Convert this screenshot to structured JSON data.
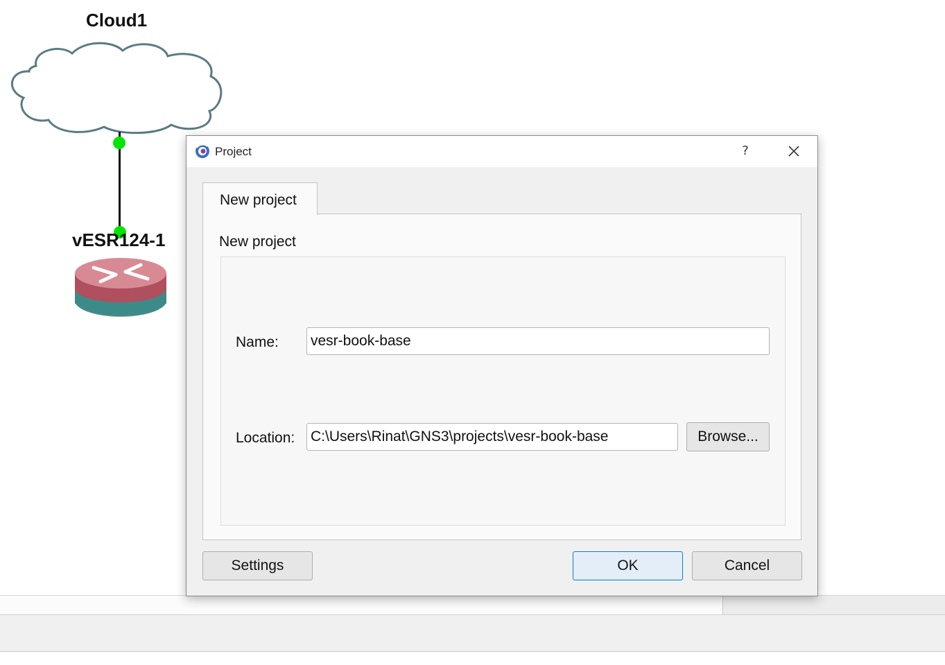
{
  "canvas": {
    "cloud_label": "Cloud1",
    "router_label": "vESR124-1",
    "port_color": "#00e600",
    "cloud_stroke": "#5b7a84"
  },
  "dialog": {
    "title": "Project",
    "app_icon": "gns3-icon",
    "help_label": "?",
    "tab_label": "New project",
    "group_title": "New project",
    "name_label": "Name:",
    "name_value": "vesr-book-base",
    "location_label": "Location:",
    "location_value": "C:\\Users\\Rinat\\GNS3\\projects\\vesr-book-base",
    "browse_label": "Browse...",
    "settings_label": "Settings",
    "ok_label": "OK",
    "cancel_label": "Cancel",
    "accent_color": "#0a7bd6"
  },
  "bottom": {
    "splitter": "......"
  }
}
